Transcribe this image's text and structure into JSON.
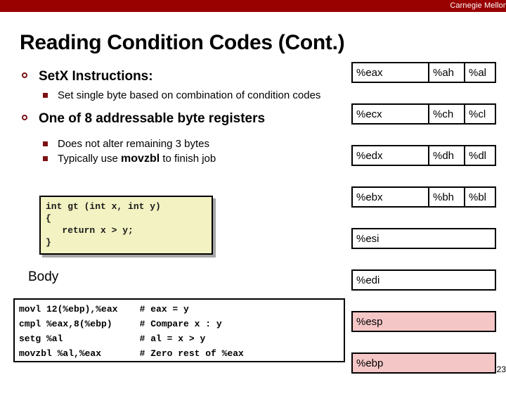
{
  "banner": {
    "text": "Carnegie Mellon",
    "color": "#990000"
  },
  "title": "Reading Condition Codes (Cont.)",
  "bullets": [
    {
      "level1": "SetX Instructions:",
      "sub": [
        "Set single byte based on combination of condition codes"
      ]
    },
    {
      "level1": "One of 8 addressable byte registers",
      "sub_a": "Does not alter remaining 3 bytes",
      "sub_b_pre": "Typically use ",
      "sub_b_code": "movzbl",
      "sub_b_post": " to finish job"
    }
  ],
  "c_code": "int gt (int x, int y)\n{\n   return x > y;\n}",
  "body_label": "Body",
  "asm_code": "movl 12(%ebp),%eax    # eax = y\ncmpl %eax,8(%ebp)     # Compare x : y\nsetg %al              # al = x > y\nmovzbl %al,%eax       # Zero rest of %eax",
  "registers": {
    "rows": [
      {
        "e": "%eax",
        "h": "%ah",
        "l": "%al",
        "highlight": false
      },
      {
        "e": "%ecx",
        "h": "%ch",
        "l": "%cl",
        "highlight": false
      },
      {
        "e": "%edx",
        "h": "%dh",
        "l": "%dl",
        "highlight": false
      },
      {
        "e": "%ebx",
        "h": "%bh",
        "l": "%bl",
        "highlight": false
      },
      {
        "e": "%esi",
        "h": "",
        "l": "",
        "highlight": false
      },
      {
        "e": "%edi",
        "h": "",
        "l": "",
        "highlight": false
      },
      {
        "e": "%esp",
        "h": "",
        "l": "",
        "highlight": true
      },
      {
        "e": "%ebp",
        "h": "",
        "l": "",
        "highlight": true
      }
    ],
    "highlight_color": "#f5c6c6"
  },
  "page_number": "23"
}
